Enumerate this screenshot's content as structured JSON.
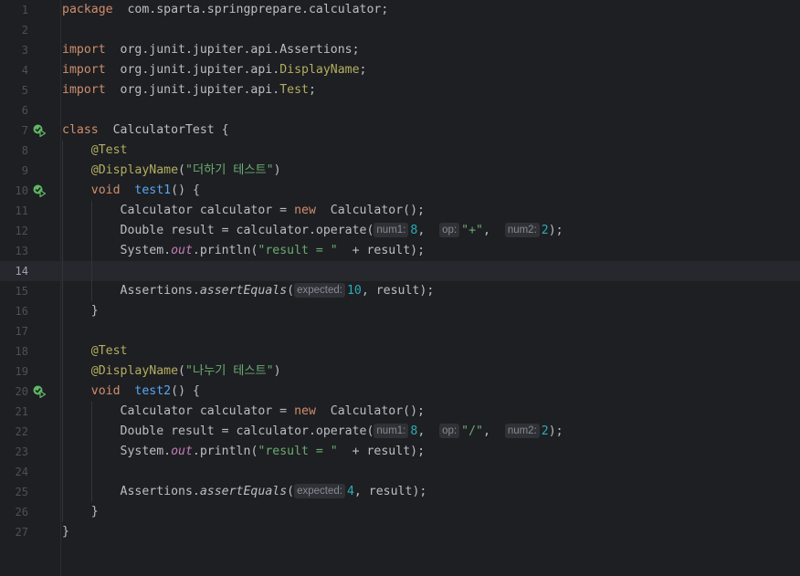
{
  "editor": {
    "current_line": 14,
    "lines": [
      {
        "n": "1",
        "t": [
          [
            "kw",
            "package"
          ],
          [
            "",
            "  com.sparta.springprepare.calculator;"
          ]
        ]
      },
      {
        "n": "2",
        "t": []
      },
      {
        "n": "3",
        "t": [
          [
            "kw",
            "import"
          ],
          [
            "",
            "  org.junit.jupiter.api.Assertions;"
          ]
        ]
      },
      {
        "n": "4",
        "t": [
          [
            "kw",
            "import"
          ],
          [
            "",
            "  org.junit.jupiter.api."
          ],
          [
            "ann",
            "DisplayName"
          ],
          [
            "",
            ";"
          ]
        ]
      },
      {
        "n": "5",
        "t": [
          [
            "kw",
            "import"
          ],
          [
            "",
            "  org.junit.jupiter.api."
          ],
          [
            "ann",
            "Test"
          ],
          [
            "",
            ";"
          ]
        ]
      },
      {
        "n": "6",
        "t": []
      },
      {
        "n": "7",
        "t": [
          [
            "kw",
            "class"
          ],
          [
            "",
            "  CalculatorTest {"
          ]
        ],
        "run": true
      },
      {
        "n": "8",
        "t": [
          [
            "",
            "    "
          ],
          [
            "ann",
            "@Test"
          ]
        ]
      },
      {
        "n": "9",
        "t": [
          [
            "",
            "    "
          ],
          [
            "ann",
            "@DisplayName"
          ],
          [
            "",
            "("
          ],
          [
            "str",
            "\"더하기 테스트\""
          ],
          [
            "",
            ")"
          ]
        ]
      },
      {
        "n": "10",
        "t": [
          [
            "",
            "    "
          ],
          [
            "kw",
            "void"
          ],
          [
            "",
            "  "
          ],
          [
            "fn",
            "test1"
          ],
          [
            "",
            "() {"
          ]
        ],
        "run": true
      },
      {
        "n": "11",
        "t": [
          [
            "",
            "        Calculator calculator = "
          ],
          [
            "kw",
            "new"
          ],
          [
            "",
            "  Calculator();"
          ]
        ]
      },
      {
        "n": "12",
        "t": [
          [
            "",
            "        Double result = calculator.operate("
          ],
          [
            "hint",
            "num1:"
          ],
          [
            "num",
            "8"
          ],
          [
            "",
            ",  "
          ],
          [
            "hint",
            "op:"
          ],
          [
            "str",
            "\"+\""
          ],
          [
            "",
            ",  "
          ],
          [
            "hint",
            "num2:"
          ],
          [
            "num",
            "2"
          ],
          [
            "",
            ");"
          ]
        ]
      },
      {
        "n": "13",
        "t": [
          [
            "",
            "        System."
          ],
          [
            "st",
            "out"
          ],
          [
            "",
            ".println("
          ],
          [
            "str",
            "\"result = \""
          ],
          [
            "",
            "  + result);"
          ]
        ]
      },
      {
        "n": "14",
        "t": []
      },
      {
        "n": "15",
        "t": [
          [
            "",
            "        Assertions."
          ],
          [
            "it",
            "assertEquals"
          ],
          [
            "",
            "("
          ],
          [
            "hint",
            "expected:"
          ],
          [
            "num",
            "10"
          ],
          [
            "",
            ", result);"
          ]
        ]
      },
      {
        "n": "16",
        "t": [
          [
            "",
            "    }"
          ]
        ]
      },
      {
        "n": "17",
        "t": []
      },
      {
        "n": "18",
        "t": [
          [
            "",
            "    "
          ],
          [
            "ann",
            "@Test"
          ]
        ]
      },
      {
        "n": "19",
        "t": [
          [
            "",
            "    "
          ],
          [
            "ann",
            "@DisplayName"
          ],
          [
            "",
            "("
          ],
          [
            "str",
            "\"나누기 테스트\""
          ],
          [
            "",
            ")"
          ]
        ]
      },
      {
        "n": "20",
        "t": [
          [
            "",
            "    "
          ],
          [
            "kw",
            "void"
          ],
          [
            "",
            "  "
          ],
          [
            "fn",
            "test2"
          ],
          [
            "",
            "() {"
          ]
        ],
        "run": true
      },
      {
        "n": "21",
        "t": [
          [
            "",
            "        Calculator calculator = "
          ],
          [
            "kw",
            "new"
          ],
          [
            "",
            "  Calculator();"
          ]
        ]
      },
      {
        "n": "22",
        "t": [
          [
            "",
            "        Double result = calculator.operate("
          ],
          [
            "hint",
            "num1:"
          ],
          [
            "num",
            "8"
          ],
          [
            "",
            ",  "
          ],
          [
            "hint",
            "op:"
          ],
          [
            "str",
            "\"/\""
          ],
          [
            "",
            ",  "
          ],
          [
            "hint",
            "num2:"
          ],
          [
            "num",
            "2"
          ],
          [
            "",
            ");"
          ]
        ]
      },
      {
        "n": "23",
        "t": [
          [
            "",
            "        System."
          ],
          [
            "st",
            "out"
          ],
          [
            "",
            ".println("
          ],
          [
            "str",
            "\"result = \""
          ],
          [
            "",
            "  + result);"
          ]
        ]
      },
      {
        "n": "24",
        "t": []
      },
      {
        "n": "25",
        "t": [
          [
            "",
            "        Assertions."
          ],
          [
            "it",
            "assertEquals"
          ],
          [
            "",
            "("
          ],
          [
            "hint",
            "expected:"
          ],
          [
            "num",
            "4"
          ],
          [
            "",
            ", result);"
          ]
        ]
      },
      {
        "n": "26",
        "t": [
          [
            "",
            "    }"
          ]
        ]
      },
      {
        "n": "27",
        "t": [
          [
            "",
            "}"
          ]
        ]
      }
    ]
  }
}
